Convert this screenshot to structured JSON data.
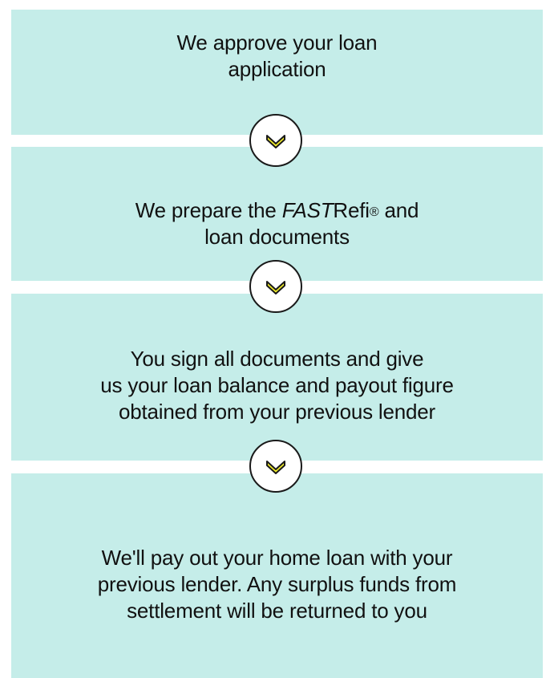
{
  "steps": [
    {
      "lines": [
        "We approve your loan",
        "application"
      ]
    },
    {
      "line1_prefix": "We prepare the ",
      "brand_italic": "FAST",
      "brand_rest": "Refi",
      "reg_mark": "®",
      "line1_suffix": " and",
      "line2": "loan documents"
    },
    {
      "lines": [
        "You sign all documents and give",
        "us your loan balance and payout figure",
        "obtained from your previous lender"
      ]
    },
    {
      "lines": [
        "We'll pay out your home loan with your",
        "previous lender. Any surplus funds from",
        "settlement will be returned to you"
      ]
    }
  ],
  "colors": {
    "step_background": "#c5ede9",
    "connector_icon_fill": "#f2ee2a",
    "connector_icon_stroke": "#1a1a1a",
    "text": "#111111"
  },
  "icons": [
    "chevron-down-icon",
    "chevron-down-icon",
    "chevron-down-icon"
  ]
}
